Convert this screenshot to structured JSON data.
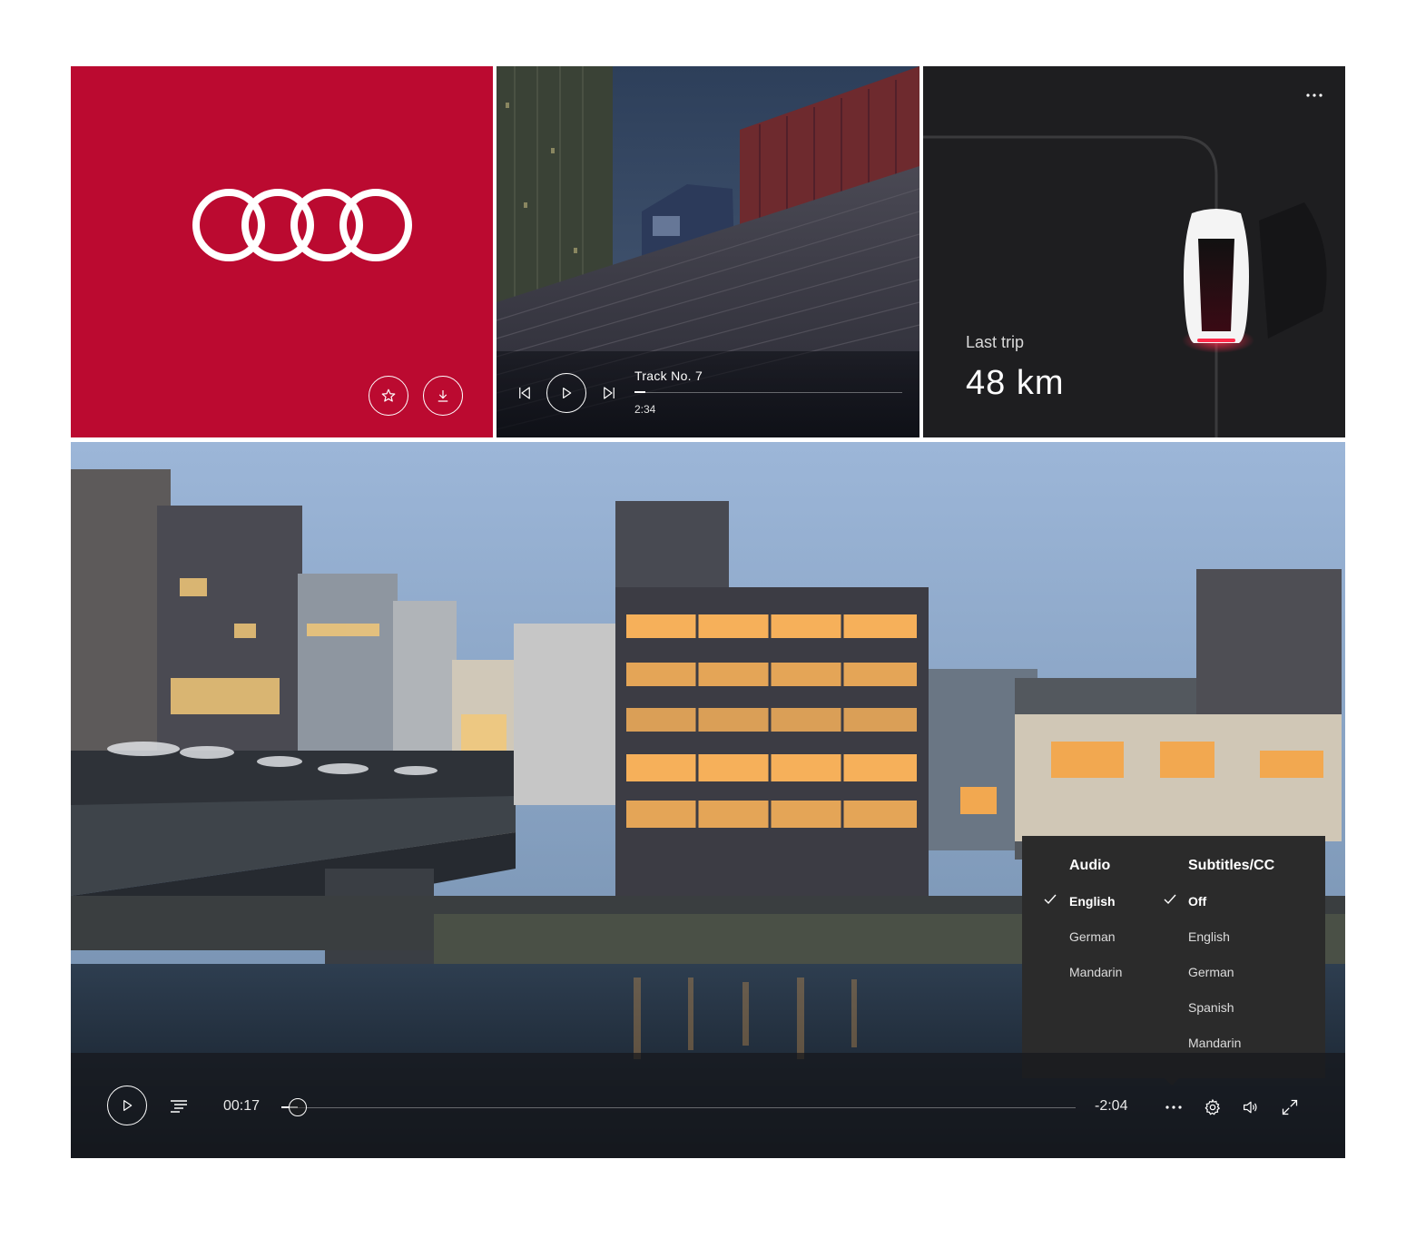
{
  "music": {
    "track_title": "Track No. 7",
    "track_time": "2:34",
    "progress_fraction": 0.04
  },
  "trip": {
    "label": "Last trip",
    "value": "48 km"
  },
  "video": {
    "time_current": "00:17",
    "time_remaining": "-2:04",
    "progress_fraction": 0.02
  },
  "menu": {
    "audio": {
      "heading": "Audio",
      "options": [
        "English",
        "German",
        "Mandarin"
      ],
      "selected_index": 0
    },
    "subtitles": {
      "heading": "Subtitles/CC",
      "options": [
        "Off",
        "English",
        "German",
        "Spanish",
        "Mandarin"
      ],
      "selected_index": 0
    }
  },
  "icons": {
    "brand_favorite": "star-icon",
    "brand_download": "download-icon",
    "music_prev": "skip-previous-icon",
    "music_play": "play-icon",
    "music_next": "skip-next-icon",
    "trip_more": "more-dots-icon",
    "video_play": "play-icon",
    "video_playlist": "playlist-icon",
    "video_more": "more-dots-icon",
    "video_settings": "gear-icon",
    "video_volume": "volume-icon",
    "video_fullscreen": "fullscreen-icon"
  },
  "colors": {
    "brand_red": "#bb0a30",
    "trip_bg": "#1e1e20",
    "menu_bg": "#2b2b2b",
    "brake_light": "#ff2a4a"
  }
}
